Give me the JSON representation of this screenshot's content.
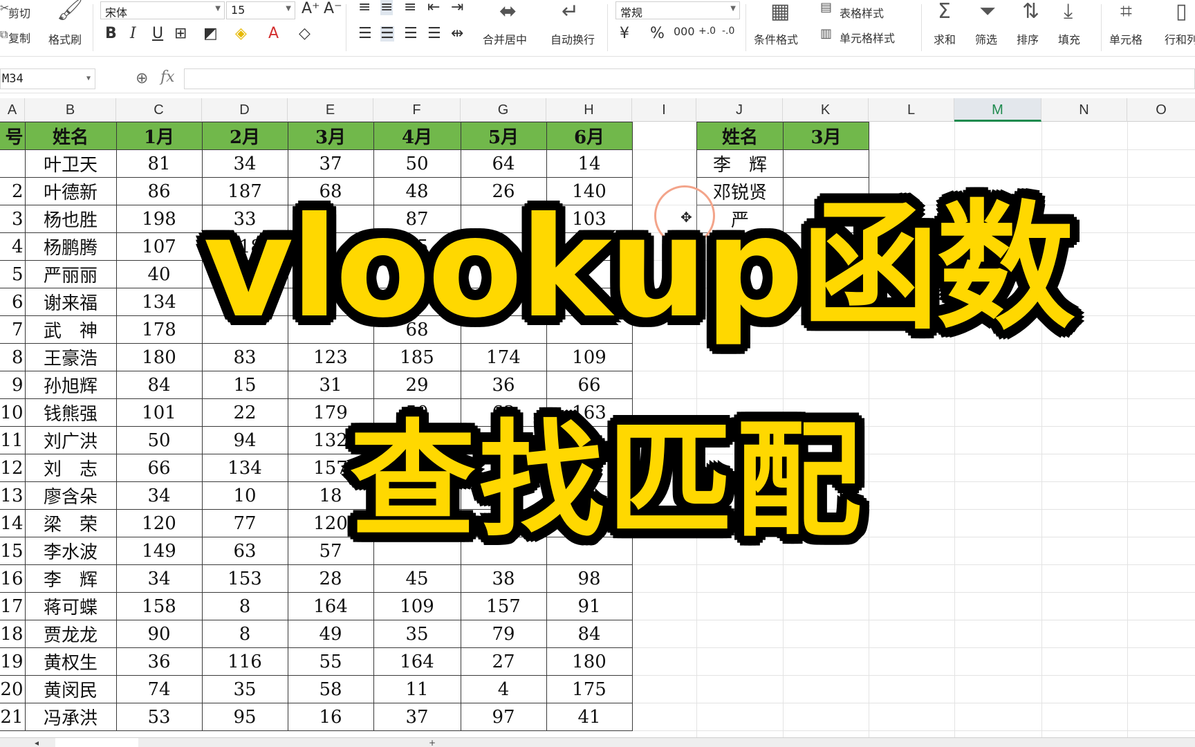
{
  "ribbon": {
    "cut": "剪切",
    "copy": "复制",
    "format_painter": "格式刷",
    "font_name": "宋体",
    "font_size": "15",
    "merge_center": "合并居中",
    "wrap_text": "自动换行",
    "number_format": "常规",
    "table_style": "表格样式",
    "conditional_format": "条件格式",
    "cell_style": "单元格样式",
    "sum": "求和",
    "filter": "筛选",
    "sort": "排序",
    "fill": "填充",
    "cell": "单元格",
    "row_col": "行和列"
  },
  "formula_bar": {
    "name_box": "M34",
    "fx": "fx",
    "value": ""
  },
  "columns": [
    "A",
    "B",
    "C",
    "D",
    "E",
    "F",
    "G",
    "H",
    "I",
    "J",
    "K",
    "L",
    "M",
    "N",
    "O"
  ],
  "selected_column": "M",
  "main_table": {
    "headers": [
      "号",
      "姓名",
      "1月",
      "2月",
      "3月",
      "4月",
      "5月",
      "6月"
    ],
    "rows": [
      [
        "",
        "叶卫天",
        "81",
        "34",
        "37",
        "50",
        "64",
        "14"
      ],
      [
        "2",
        "叶德新",
        "86",
        "187",
        "68",
        "48",
        "26",
        "140"
      ],
      [
        "3",
        "杨也胜",
        "198",
        "33",
        "8",
        "87",
        "",
        "103"
      ],
      [
        "4",
        "杨鹏腾",
        "107",
        "118",
        "",
        "85",
        "",
        "65"
      ],
      [
        "5",
        "严丽丽",
        "40",
        "",
        "",
        "",
        "",
        ""
      ],
      [
        "6",
        "谢来福",
        "134",
        "",
        "",
        "",
        "",
        ""
      ],
      [
        "7",
        "武　神",
        "178",
        "",
        "",
        "68",
        "",
        ""
      ],
      [
        "8",
        "王豪浩",
        "180",
        "83",
        "123",
        "185",
        "174",
        "109"
      ],
      [
        "9",
        "孙旭辉",
        "84",
        "15",
        "31",
        "29",
        "36",
        "66"
      ],
      [
        "10",
        "钱熊强",
        "101",
        "22",
        "179",
        "50",
        "63",
        "163"
      ],
      [
        "11",
        "刘广洪",
        "50",
        "94",
        "132",
        "",
        "",
        ""
      ],
      [
        "12",
        "刘　志",
        "66",
        "134",
        "157",
        "",
        "",
        ""
      ],
      [
        "13",
        "廖含朵",
        "34",
        "10",
        "18",
        "",
        "",
        ""
      ],
      [
        "14",
        "梁　荣",
        "120",
        "77",
        "120",
        "",
        "",
        "7"
      ],
      [
        "15",
        "李水波",
        "149",
        "63",
        "57",
        "",
        "",
        ""
      ],
      [
        "16",
        "李　辉",
        "34",
        "153",
        "28",
        "45",
        "38",
        "98"
      ],
      [
        "17",
        "蒋可蝶",
        "158",
        "8",
        "164",
        "109",
        "157",
        "91"
      ],
      [
        "18",
        "贾龙龙",
        "90",
        "8",
        "49",
        "35",
        "79",
        "84"
      ],
      [
        "19",
        "黄权生",
        "36",
        "116",
        "55",
        "164",
        "27",
        "180"
      ],
      [
        "20",
        "黄闵民",
        "74",
        "35",
        "58",
        "11",
        "4",
        "175"
      ],
      [
        "21",
        "冯承洪",
        "53",
        "95",
        "16",
        "37",
        "97",
        "41"
      ]
    ]
  },
  "lookup_table": {
    "headers": [
      "姓名",
      "3月"
    ],
    "rows": [
      [
        "李　辉",
        ""
      ],
      [
        "邓锐贤",
        ""
      ],
      [
        "严",
        ""
      ]
    ]
  },
  "overlay": {
    "title_line1": "vlookup函数",
    "title_line2": "查找匹配"
  },
  "colors": {
    "header_green": "#71b84b",
    "overlay_yellow": "#ffd800",
    "selected_col_accent": "#1e8a4e"
  }
}
